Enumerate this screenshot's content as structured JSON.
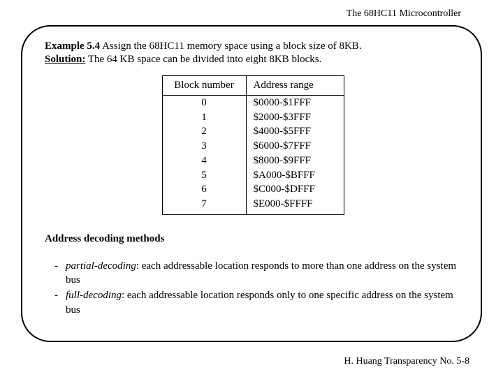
{
  "header": {
    "title": "The 68HC11 Microcontroller"
  },
  "example": {
    "label": "Example 5.4",
    "text": " Assign the 68HC11 memory space using a block size of 8KB."
  },
  "solution": {
    "label": "Solution:",
    "text": " The 64 KB space can be divided into eight 8KB blocks."
  },
  "table": {
    "headers": {
      "block": "Block number",
      "range": "Address range"
    },
    "rows": [
      {
        "block": "0",
        "range": "$0000-$1FFF"
      },
      {
        "block": "1",
        "range": "$2000-$3FFF"
      },
      {
        "block": "2",
        "range": "$4000-$5FFF"
      },
      {
        "block": "3",
        "range": "$6000-$7FFF"
      },
      {
        "block": "4",
        "range": "$8000-$9FFF"
      },
      {
        "block": "5",
        "range": "$A000-$BFFF"
      },
      {
        "block": "6",
        "range": "$C000-$DFFF"
      },
      {
        "block": "7",
        "range": "$E000-$FFFF"
      }
    ]
  },
  "section": {
    "title": "Address decoding methods"
  },
  "bullets": [
    {
      "term": "partial-decoding",
      "desc": ": each addressable location responds to more than one address on the system bus"
    },
    {
      "term": "full-decoding",
      "desc": ": each addressable location responds only to one specific address on the system bus"
    }
  ],
  "footer": {
    "text": "H. Huang Transparency No. 5-8"
  }
}
